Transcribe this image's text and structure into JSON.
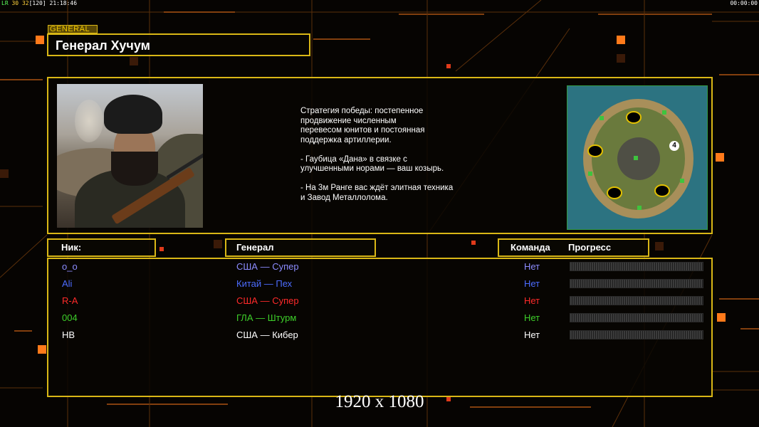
{
  "overlay": {
    "fps_prefix": "LR",
    "fps": "30",
    "fps_target": "32",
    "fps_max": "[120]",
    "clock_left": "21:18:46",
    "clock_right": "00:00:00"
  },
  "general_tag": "GENERAL",
  "title": "Генерал Хучум",
  "strategy_text": "Стратегия победы: постепенное\nпродвижение численным\nперевесом юнитов и постоянная\nподдержка артиллерии.\n\n- Гаубица «Дана» в связке с\nулучшенными норами — ваш козырь.\n\n- На 3м Ранге вас ждёт элитная техника\nи Завод Металлолома.",
  "map": {
    "player_count_marker": "4"
  },
  "headers": {
    "nick": "Ник:",
    "general": "Генерал",
    "team": "Команда",
    "progress": "Прогресс"
  },
  "players": [
    {
      "nick": "o_o",
      "general": "США — Супер",
      "team": "Нет",
      "progress": 0,
      "color": "#8c8cff"
    },
    {
      "nick": "Ali",
      "general": "Китай — Пех",
      "team": "Нет",
      "progress": 0,
      "color": "#4c6cff"
    },
    {
      "nick": "R-A",
      "general": "США — Супер",
      "team": "Нет",
      "progress": 0,
      "color": "#ff2a2a"
    },
    {
      "nick": "004",
      "general": "ГЛА — Штурм",
      "team": "Нет",
      "progress": 0,
      "color": "#3ecf2a"
    },
    {
      "nick": "HB",
      "general": "США — Кибер",
      "team": "Нет",
      "progress": 0,
      "color": "#ffffff"
    }
  ],
  "resolution_label": "1920 x 1080",
  "colors": {
    "accent": "#d9b716",
    "orange": "#ff7a1a"
  }
}
